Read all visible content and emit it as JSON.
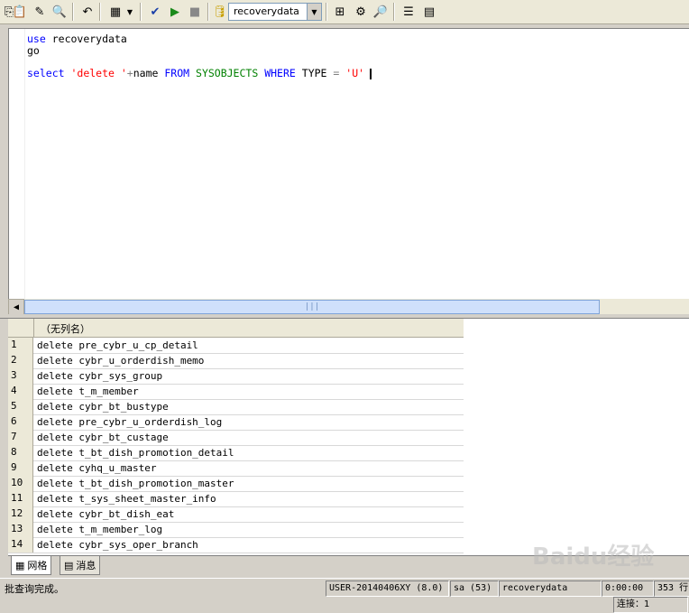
{
  "toolbar": {
    "database": "recoverydata",
    "icons": [
      "copy-icon",
      "paste-icon",
      "edit-icon",
      "find-icon",
      "undo-icon",
      "grid-mode-icon",
      "parse-icon",
      "execute-icon",
      "stop-icon",
      "database-icon",
      "show-plan-icon",
      "object-browser-icon",
      "find-object-icon",
      "properties-icon",
      "results-pane-icon"
    ]
  },
  "editor": {
    "line1_kw": "use",
    "line1_obj": "recoverydata",
    "line2_kw": "go",
    "line3_select": "select",
    "line3_str1": "'delete '",
    "line3_plus": "+",
    "line3_name": "name",
    "line3_from": "FROM",
    "line3_sysobj": "SYSOBJECTS",
    "line3_where": "WHERE",
    "line3_type": "TYPE",
    "line3_eq": "=",
    "line3_str2": "'U'"
  },
  "grid": {
    "column": "（无列名）",
    "rows": [
      {
        "n": "1",
        "v": "delete pre_cybr_u_cp_detail"
      },
      {
        "n": "2",
        "v": "delete cybr_u_orderdish_memo"
      },
      {
        "n": "3",
        "v": "delete cybr_sys_group"
      },
      {
        "n": "4",
        "v": "delete t_m_member"
      },
      {
        "n": "5",
        "v": "delete cybr_bt_bustype"
      },
      {
        "n": "6",
        "v": "delete pre_cybr_u_orderdish_log"
      },
      {
        "n": "7",
        "v": "delete cybr_bt_custage"
      },
      {
        "n": "8",
        "v": "delete t_bt_dish_promotion_detail"
      },
      {
        "n": "9",
        "v": "delete cyhq_u_master"
      },
      {
        "n": "10",
        "v": "delete t_bt_dish_promotion_master"
      },
      {
        "n": "11",
        "v": "delete t_sys_sheet_master_info"
      },
      {
        "n": "12",
        "v": "delete cybr_bt_dish_eat"
      },
      {
        "n": "13",
        "v": "delete t_m_member_log"
      },
      {
        "n": "14",
        "v": "delete cybr_sys_oper_branch"
      }
    ]
  },
  "tabs": {
    "grid": "网格",
    "messages": "消息"
  },
  "status": {
    "message": "批查询完成。",
    "server": "USER-20140406XY (8.0)",
    "user": "sa (53)",
    "db": "recoverydata",
    "time": "0:00:00",
    "rows": "353 行",
    "conn": "连接：1"
  },
  "watermark": "Baidu经验"
}
